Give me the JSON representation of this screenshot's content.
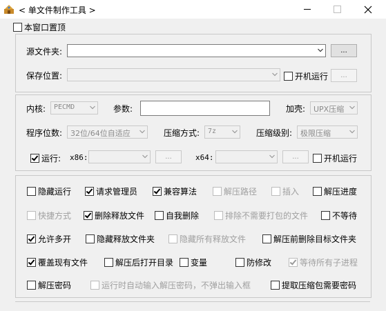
{
  "window": {
    "title": "< 单文件制作工具 >"
  },
  "top": {
    "stay_on_top": {
      "label": "本窗口置顶",
      "checked": false
    }
  },
  "source": {
    "source_label": "源文件夹:",
    "source_value": "",
    "browse": "...",
    "save_label": "保存位置:",
    "save_value": "",
    "startup_label": "开机运行",
    "browse2": "..."
  },
  "settings": {
    "kernel_label": "内核:",
    "kernel_value": "PECMD",
    "params_label": "参数:",
    "params_value": "",
    "shell_label": "加壳:",
    "shell_value": "UPX压缩",
    "arch_label": "程序位数:",
    "arch_value": "32位/64位自适应",
    "compress_label": "压缩方式:",
    "compress_value": "7z",
    "level_label": "压缩级别:",
    "level_value": "极限压缩",
    "run_label": "运行:",
    "run_checked": true,
    "x86_label": "x86:",
    "x86_value": "",
    "x86_browse": "...",
    "x64_label": "x64:",
    "x64_value": "",
    "x64_browse": "...",
    "run_startup_label": "开机运行"
  },
  "options": [
    {
      "label": "隐藏运行",
      "checked": false,
      "enabled": true
    },
    {
      "label": "请求管理员",
      "checked": true,
      "enabled": true
    },
    {
      "label": "兼容算法",
      "checked": true,
      "enabled": true
    },
    {
      "label": "解压路径",
      "checked": false,
      "enabled": false
    },
    {
      "label": "插入",
      "checked": false,
      "enabled": false
    },
    {
      "label": "解压进度",
      "checked": false,
      "enabled": true
    },
    {
      "label": "快捷方式",
      "checked": false,
      "enabled": false
    },
    {
      "label": "删除释放文件",
      "checked": true,
      "enabled": true
    },
    {
      "label": "自我删除",
      "checked": false,
      "enabled": true
    },
    {
      "label": "排除不需要打包的文件",
      "checked": false,
      "enabled": false
    },
    {
      "label": "不等待",
      "checked": false,
      "enabled": true
    },
    {
      "label": "允许多开",
      "checked": true,
      "enabled": true
    },
    {
      "label": "隐藏释放文件夹",
      "checked": false,
      "enabled": true
    },
    {
      "label": "隐藏所有释放文件",
      "checked": false,
      "enabled": false
    },
    {
      "label": "解压前删除目标文件夹",
      "checked": false,
      "enabled": true
    },
    {
      "label": "覆盖现有文件",
      "checked": true,
      "enabled": true
    },
    {
      "label": "解压后打开目录",
      "checked": false,
      "enabled": true
    },
    {
      "label": "变量",
      "checked": false,
      "enabled": true
    },
    {
      "label": "防修改",
      "checked": false,
      "enabled": true
    },
    {
      "label": "等待所有子进程",
      "checked": true,
      "enabled": false
    },
    {
      "label": "解压密码",
      "checked": false,
      "enabled": true
    },
    {
      "label": "运行时自动输入解压密码，不弹出输入框",
      "checked": false,
      "enabled": false
    },
    {
      "label": "提取压缩包需要密码",
      "checked": false,
      "enabled": true
    }
  ]
}
